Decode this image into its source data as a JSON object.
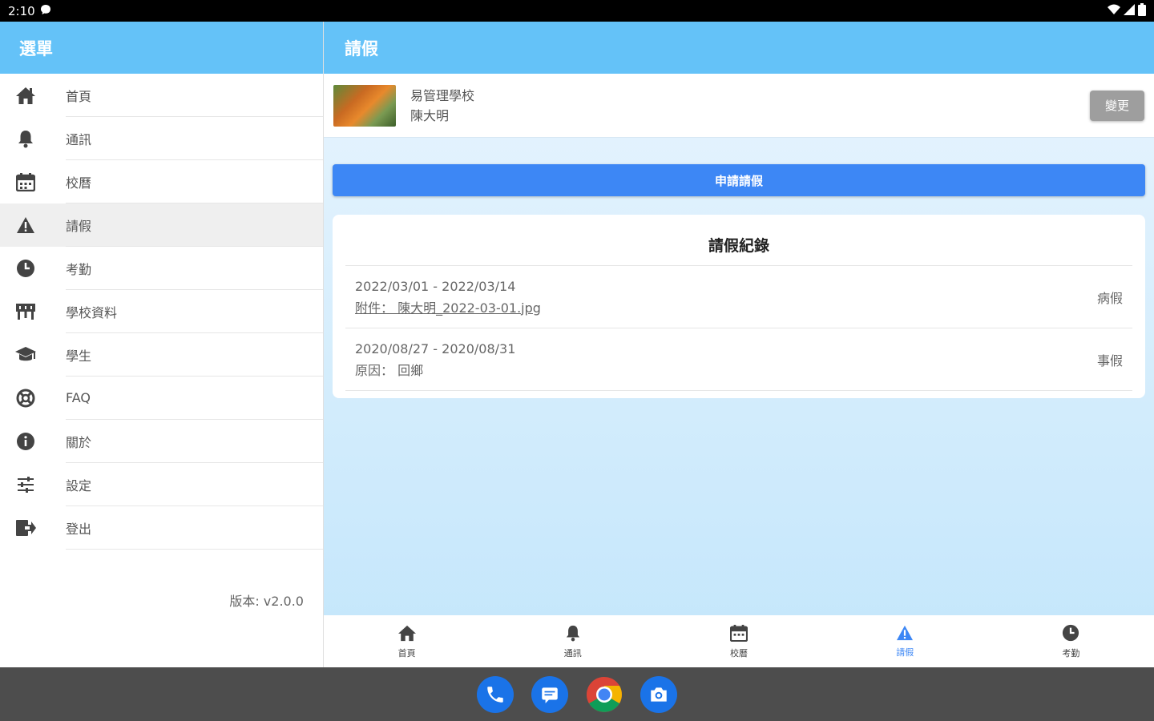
{
  "status_bar": {
    "time": "2:10"
  },
  "sidebar": {
    "title": "選單",
    "items": [
      {
        "label": "首頁",
        "icon": "home-icon"
      },
      {
        "label": "通訊",
        "icon": "bell-icon"
      },
      {
        "label": "校曆",
        "icon": "calendar-icon"
      },
      {
        "label": "請假",
        "icon": "warning-icon",
        "active": true
      },
      {
        "label": "考勤",
        "icon": "clock-icon"
      },
      {
        "label": "學校資料",
        "icon": "school-icon"
      },
      {
        "label": "學生",
        "icon": "graduation-cap-icon"
      },
      {
        "label": "FAQ",
        "icon": "lifebuoy-icon"
      },
      {
        "label": "關於",
        "icon": "info-icon"
      },
      {
        "label": "設定",
        "icon": "sliders-icon"
      },
      {
        "label": "登出",
        "icon": "logout-icon"
      }
    ],
    "version": "版本: v2.0.0"
  },
  "main": {
    "title": "請假",
    "profile": {
      "school": "易管理學校",
      "student": "陳大明",
      "change_label": "變更"
    },
    "apply_label": "申請請假",
    "records": {
      "title": "請假紀錄",
      "rows": [
        {
          "dates": "2022/03/01 - 2022/03/14",
          "detail": "附件：  陳大明_2022-03-01.jpg",
          "type": "病假"
        },
        {
          "dates": "2020/08/27 - 2020/08/31",
          "detail": "原因：  回鄉",
          "type": "事假"
        }
      ]
    }
  },
  "bottom_nav": {
    "items": [
      {
        "label": "首頁",
        "icon": "home-icon"
      },
      {
        "label": "通訊",
        "icon": "bell-icon"
      },
      {
        "label": "校曆",
        "icon": "calendar-icon"
      },
      {
        "label": "請假",
        "icon": "warning-icon",
        "active": true
      },
      {
        "label": "考勤",
        "icon": "clock-icon"
      }
    ]
  },
  "dock": {
    "apps": [
      "phone-icon",
      "messages-icon",
      "chrome-icon",
      "camera-icon"
    ]
  },
  "colors": {
    "header": "#64c2f8",
    "accent": "#3d87f5",
    "change_button": "#9e9e9e"
  }
}
